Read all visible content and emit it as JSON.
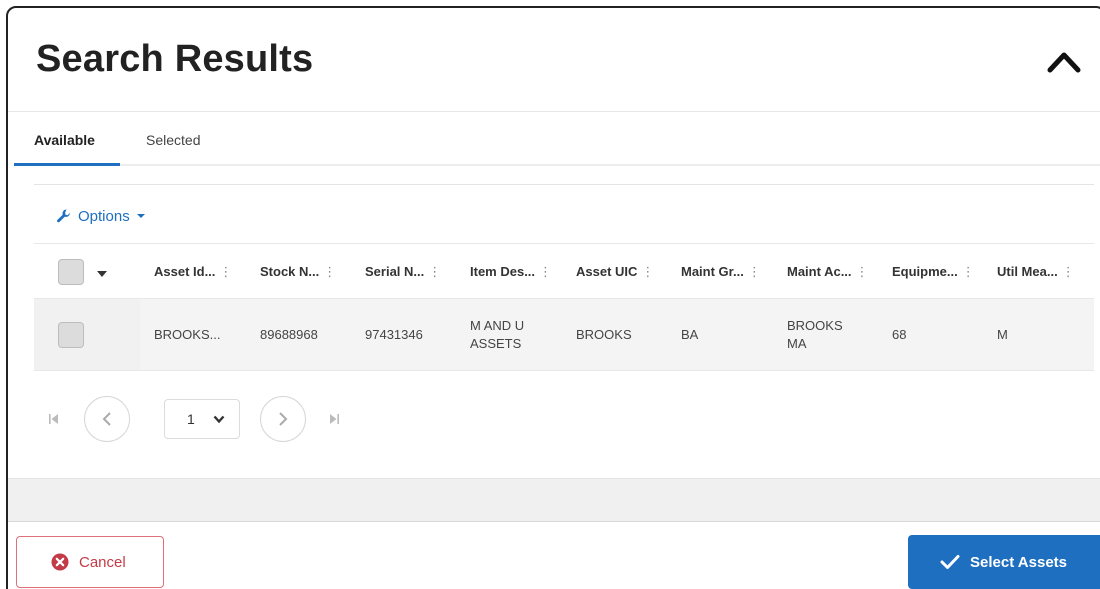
{
  "header": {
    "title": "Search Results"
  },
  "tabs": [
    {
      "label": "Available",
      "active": true
    },
    {
      "label": "Selected",
      "active": false
    }
  ],
  "toolbar": {
    "options_label": "Options"
  },
  "table": {
    "columns": [
      "Asset Id...",
      "Stock N...",
      "Serial N...",
      "Item Des...",
      "Asset UIC",
      "Maint Gr...",
      "Maint Ac...",
      "Equipme...",
      "Util Mea..."
    ],
    "rows": [
      {
        "cells": [
          "BROOKS...",
          "89688968",
          "97431346",
          "M AND U ASSETS",
          "BROOKS",
          "BA",
          "BROOKS MA",
          "68",
          "M"
        ]
      }
    ]
  },
  "pager": {
    "current_page": "1"
  },
  "footer": {
    "cancel_label": "Cancel",
    "select_label": "Select Assets"
  },
  "colors": {
    "accent": "#1f6fc0",
    "danger": "#c23b46"
  },
  "icons": {
    "collapse": "chevron-up-icon",
    "options": "wrench-icon",
    "cancel": "x-circle-icon",
    "select": "check-icon"
  }
}
